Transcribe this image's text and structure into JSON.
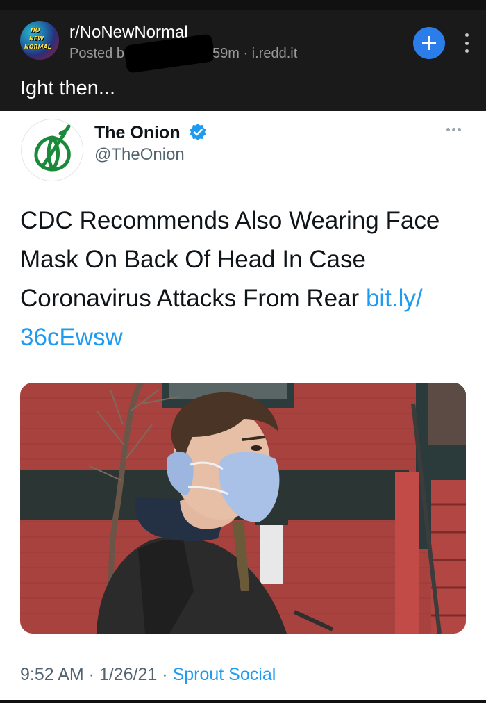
{
  "post": {
    "subreddit": "r/NoNewNormal",
    "avatar_text": [
      "NO",
      "NEW",
      "NORMAL"
    ],
    "posted_by_prefix": "Posted b",
    "meta": "59m · i.redd.it",
    "title": "Ight then...",
    "join_icon": "plus-icon",
    "more_icon": "vertical-ellipsis-icon"
  },
  "tweet": {
    "author_name": "The Onion",
    "handle": "@TheOnion",
    "verified_icon": "verified-badge-icon",
    "text": "CDC Recommends Also Wearing Face Mask On Back Of Head In Case Coronavirus Attacks From Rear ",
    "link_line1": "bit.ly/",
    "link_line2": "36cEwsw",
    "timestamp": "9:52 AM · 1/26/21 · ",
    "source": "Sprout Social"
  },
  "colors": {
    "header_bg": "#1a1a1b",
    "reddit_blue": "#2b7de9",
    "twitter_blue": "#1d9bf0",
    "onion_green": "#1a8a3a",
    "brick": "#a8423f"
  }
}
